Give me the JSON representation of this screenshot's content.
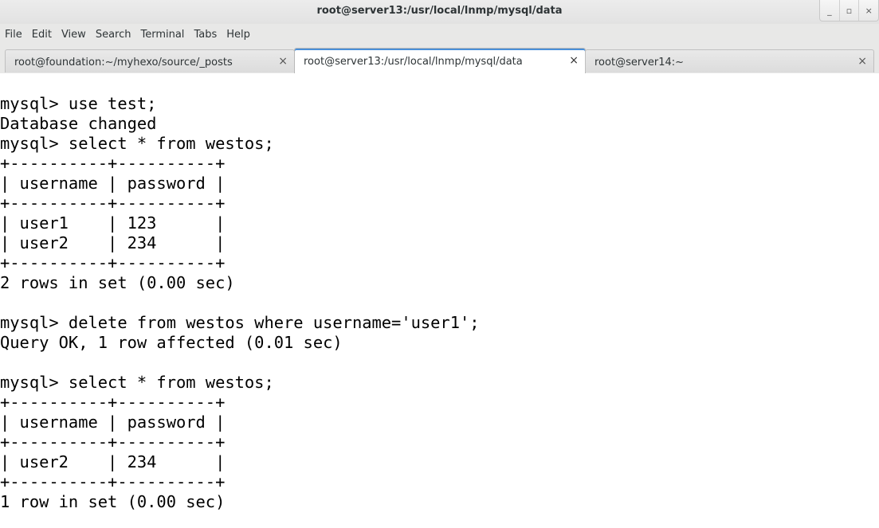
{
  "window": {
    "title": "root@server13:/usr/local/lnmp/mysql/data",
    "buttons": {
      "minimize": "_",
      "maximize": "▫",
      "close": "×"
    }
  },
  "menubar": {
    "items": [
      "File",
      "Edit",
      "View",
      "Search",
      "Terminal",
      "Tabs",
      "Help"
    ]
  },
  "tabs": [
    {
      "label": "root@foundation:~/myhexo/source/_posts",
      "close": "×",
      "active": false
    },
    {
      "label": "root@server13:/usr/local/lnmp/mysql/data",
      "close": "×",
      "active": true
    },
    {
      "label": "root@server14:~",
      "close": "×",
      "active": false
    }
  ],
  "terminal": {
    "lines": [
      "mysql> use test;",
      "Database changed",
      "mysql> select * from westos;",
      "+----------+----------+",
      "| username | password |",
      "+----------+----------+",
      "| user1    | 123      |",
      "| user2    | 234      |",
      "+----------+----------+",
      "2 rows in set (0.00 sec)",
      "",
      "mysql> delete from westos where username='user1';",
      "Query OK, 1 row affected (0.01 sec)",
      "",
      "mysql> select * from westos;",
      "+----------+----------+",
      "| username | password |",
      "+----------+----------+",
      "| user2    | 234      |",
      "+----------+----------+",
      "1 row in set (0.00 sec)"
    ]
  }
}
